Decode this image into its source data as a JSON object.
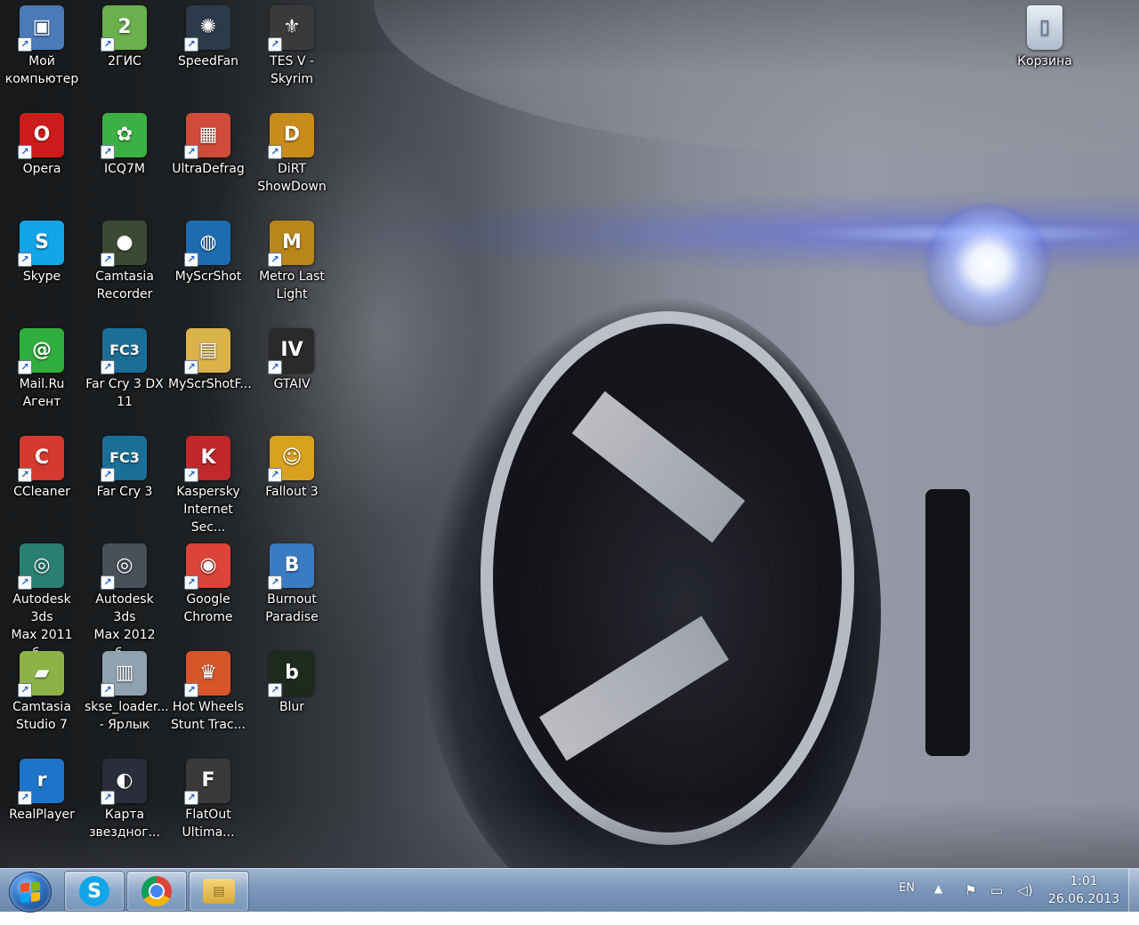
{
  "desktop": {
    "icons": [
      {
        "label": "Мой\nкомпьютер",
        "icon": "computer-icon",
        "color": "#4a7ab8",
        "glyph": "▣",
        "shortcut": true
      },
      {
        "label": "2ГИС",
        "icon": "2gis-icon",
        "color": "#6ab04c",
        "glyph": "2",
        "shortcut": true
      },
      {
        "label": "SpeedFan",
        "icon": "speedfan-icon",
        "color": "#2c3a4a",
        "glyph": "✺",
        "shortcut": true
      },
      {
        "label": "TES V -\nSkyrim",
        "icon": "skyrim-icon",
        "color": "#3a3a3a",
        "glyph": "⚜",
        "shortcut": true
      },
      {
        "label": "Opera",
        "icon": "opera-icon",
        "color": "#cc1b1b",
        "glyph": "O",
        "shortcut": true
      },
      {
        "label": "ICQ7M",
        "icon": "icq-icon",
        "color": "#3cb043",
        "glyph": "✿",
        "shortcut": true
      },
      {
        "label": "UltraDefrag",
        "icon": "ultradefrag-icon",
        "color": "#d14b3b",
        "glyph": "▦",
        "shortcut": true
      },
      {
        "label": "DiRT\nShowDown",
        "icon": "dirt-icon",
        "color": "#c98b1a",
        "glyph": "D",
        "shortcut": true
      },
      {
        "label": "Skype",
        "icon": "skype-icon",
        "color": "#12a5e8",
        "glyph": "S",
        "shortcut": true
      },
      {
        "label": "Camtasia\nRecorder",
        "icon": "camtasia-recorder-icon",
        "color": "#3d4a33",
        "glyph": "●",
        "shortcut": true
      },
      {
        "label": "MyScrShot",
        "icon": "myscrshot-icon",
        "color": "#1e6bb0",
        "glyph": "◍",
        "shortcut": true
      },
      {
        "label": "Metro Last\nLight",
        "icon": "metro-icon",
        "color": "#b8861a",
        "glyph": "M",
        "shortcut": true
      },
      {
        "label": "Mail.Ru\nАгент",
        "icon": "mailru-agent-icon",
        "color": "#2fae3e",
        "glyph": "@",
        "shortcut": true
      },
      {
        "label": "Far Cry 3 DX\n11",
        "icon": "farcry3-dx11-icon",
        "color": "#1b6f96",
        "glyph": "FC3",
        "shortcut": true
      },
      {
        "label": "MyScrShotF...",
        "icon": "folder-icon",
        "color": "#d9b24a",
        "glyph": "▤",
        "shortcut": true
      },
      {
        "label": "GTAIV",
        "icon": "gtaiv-icon",
        "color": "#2a2a2a",
        "glyph": "IV",
        "shortcut": true
      },
      {
        "label": "CCleaner",
        "icon": "ccleaner-icon",
        "color": "#d43a2f",
        "glyph": "C",
        "shortcut": true
      },
      {
        "label": "Far Cry 3",
        "icon": "farcry3-icon",
        "color": "#1b6f96",
        "glyph": "FC3",
        "shortcut": true
      },
      {
        "label": "Kaspersky\nInternet Sec...",
        "icon": "kaspersky-icon",
        "color": "#c0282c",
        "glyph": "K",
        "shortcut": true
      },
      {
        "label": "Fallout 3",
        "icon": "fallout3-icon",
        "color": "#d8a21e",
        "glyph": "☺",
        "shortcut": true
      },
      {
        "label": "Autodesk 3ds\nMax 2011 6...",
        "icon": "3dsmax-2011-icon",
        "color": "#2a7f73",
        "glyph": "◎",
        "shortcut": true
      },
      {
        "label": "Autodesk 3ds\nMax 2012 6...",
        "icon": "3dsmax-2012-icon",
        "color": "#4a5058",
        "glyph": "◎",
        "shortcut": true
      },
      {
        "label": "Google\nChrome",
        "icon": "chrome-icon",
        "color": "#db4437",
        "glyph": "◉",
        "shortcut": true
      },
      {
        "label": "Burnout\nParadise",
        "icon": "burnout-icon",
        "color": "#3a7cc4",
        "glyph": "B",
        "shortcut": true
      },
      {
        "label": "Camtasia\nStudio 7",
        "icon": "camtasia-studio-icon",
        "color": "#8db347",
        "glyph": "▰",
        "shortcut": true
      },
      {
        "label": "skse_loader...\n- Ярлык",
        "icon": "skse-loader-icon",
        "color": "#8fa2b0",
        "glyph": "▥",
        "shortcut": true
      },
      {
        "label": "Hot Wheels\nStunt Trac...",
        "icon": "hotwheels-icon",
        "color": "#d8552a",
        "glyph": "♛",
        "shortcut": true
      },
      {
        "label": "Blur",
        "icon": "blur-icon",
        "color": "#1f2a1f",
        "glyph": "b",
        "shortcut": true
      },
      {
        "label": "RealPlayer",
        "icon": "realplayer-icon",
        "color": "#1e74c8",
        "glyph": "r",
        "shortcut": true
      },
      {
        "label": "Карта\nзвездног...",
        "icon": "star-map-icon",
        "color": "#2b2e3a",
        "glyph": "◐",
        "shortcut": true
      },
      {
        "label": "FlatOut\nUltima...",
        "icon": "flatout-icon",
        "color": "#3a3a3a",
        "glyph": "F",
        "shortcut": true
      }
    ],
    "recycle_bin": {
      "label": "Корзина",
      "icon": "recycle-bin-icon",
      "color": "#c8d4e2",
      "glyph": "▯"
    }
  },
  "taskbar": {
    "start_button": {
      "icon": "windows-start-icon"
    },
    "pinned": [
      {
        "name": "skype",
        "icon": "skype-icon",
        "color": "#12a5e8",
        "glyph": "S"
      },
      {
        "name": "chrome",
        "icon": "chrome-icon",
        "color": "#db4437",
        "glyph": "◉"
      },
      {
        "name": "explorer",
        "icon": "folder-icon",
        "color": "#d9b24a",
        "glyph": "▤"
      }
    ],
    "tray": {
      "language": "EN",
      "show_hidden_icon": "▲",
      "icons": [
        {
          "name": "action-center-flag-icon",
          "glyph": "⚑"
        },
        {
          "name": "network-icon",
          "glyph": "▭"
        },
        {
          "name": "volume-icon",
          "glyph": "◁)"
        }
      ]
    },
    "clock": {
      "time": "1:01",
      "date": "26.06.2013"
    }
  }
}
